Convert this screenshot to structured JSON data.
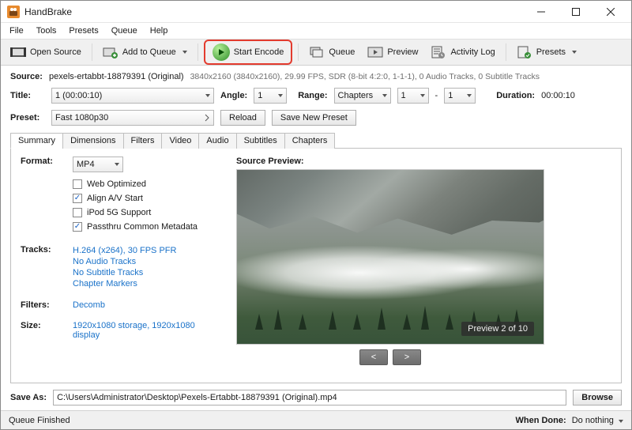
{
  "title": "HandBrake",
  "menu": [
    "File",
    "Tools",
    "Presets",
    "Queue",
    "Help"
  ],
  "toolbar": {
    "open": "Open Source",
    "addq": "Add to Queue",
    "start": "Start Encode",
    "queue": "Queue",
    "preview": "Preview",
    "log": "Activity Log",
    "presets": "Presets"
  },
  "source": {
    "label": "Source:",
    "name": "pexels-ertabbt-18879391 (Original)",
    "info": "3840x2160 (3840x2160), 29.99 FPS, SDR (8-bit 4:2:0, 1-1-1), 0 Audio Tracks, 0 Subtitle Tracks"
  },
  "title_row": {
    "label": "Title:",
    "value": "1  (00:00:10)",
    "angle_label": "Angle:",
    "angle": "1",
    "range_label": "Range:",
    "range_type": "Chapters",
    "range_from": "1",
    "range_sep": "-",
    "range_to": "1",
    "dur_label": "Duration:",
    "dur": "00:00:10"
  },
  "preset_row": {
    "label": "Preset:",
    "value": "Fast 1080p30",
    "reload": "Reload",
    "savenew": "Save New Preset"
  },
  "tabs": [
    "Summary",
    "Dimensions",
    "Filters",
    "Video",
    "Audio",
    "Subtitles",
    "Chapters"
  ],
  "summary": {
    "format_label": "Format:",
    "format": "MP4",
    "cb": [
      "Web Optimized",
      "Align A/V Start",
      "iPod 5G Support",
      "Passthru Common Metadata"
    ],
    "cb_checked": [
      false,
      true,
      false,
      true
    ],
    "tracks_label": "Tracks:",
    "tracks": [
      "H.264 (x264), 30 FPS PFR",
      "No Audio Tracks",
      "No Subtitle Tracks",
      "Chapter Markers"
    ],
    "filters_label": "Filters:",
    "filters": "Decomb",
    "size_label": "Size:",
    "size": "1920x1080 storage, 1920x1080 display",
    "preview_label": "Source Preview:",
    "preview_badge": "Preview 2 of 10",
    "prev": "<",
    "next": ">"
  },
  "save": {
    "label": "Save As:",
    "path": "C:\\Users\\Administrator\\Desktop\\Pexels-Ertabbt-18879391 (Original).mp4",
    "browse": "Browse"
  },
  "status": {
    "left": "Queue Finished",
    "done_label": "When Done:",
    "done": "Do nothing"
  }
}
